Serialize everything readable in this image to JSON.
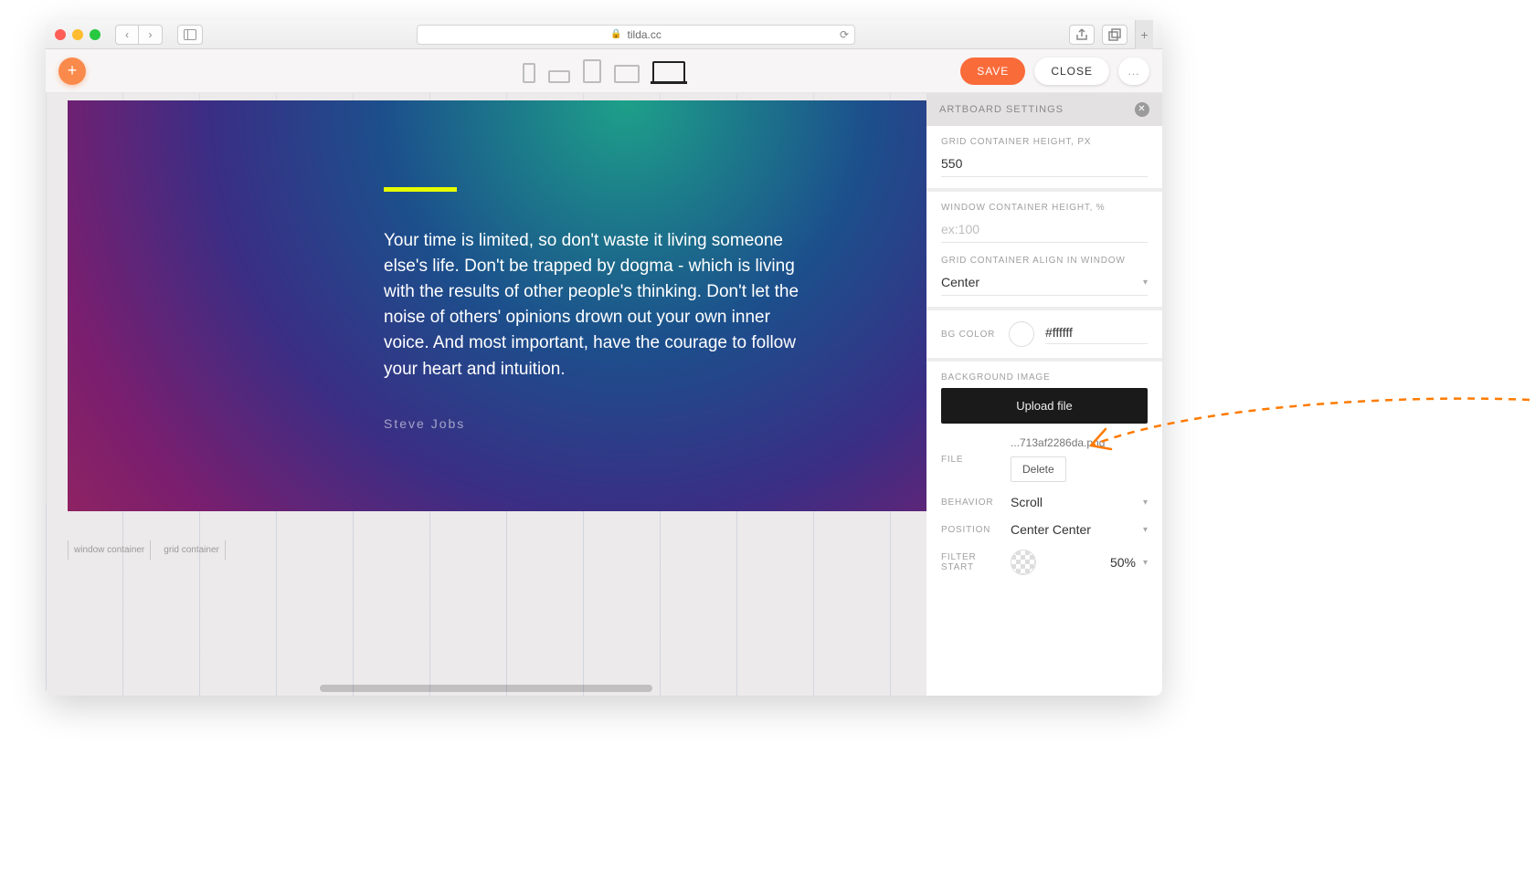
{
  "browser": {
    "url": "tilda.cc",
    "lock_icon": "🔒"
  },
  "appbar": {
    "save": "SAVE",
    "close": "CLOSE",
    "more": "..."
  },
  "canvas": {
    "quote": "Your time is limited, so don't waste it living someone else's life. Don't be trapped by dogma - which is living with the results of other people's thinking. Don't let the noise of others' opinions drown out your own inner voice. And most important, have the courage to follow your heart and intuition.",
    "attribution": "Steve Jobs",
    "rulers": {
      "window": "window container",
      "grid": "grid container"
    }
  },
  "panel": {
    "title": "ARTBOARD SETTINGS",
    "gridHeight": {
      "label": "GRID CONTAINER HEIGHT, PX",
      "value": "550"
    },
    "windowHeight": {
      "label": "WINDOW CONTAINER HEIGHT, %",
      "placeholder": "ex:100"
    },
    "align": {
      "label": "GRID CONTAINER ALIGN IN WINDOW",
      "value": "Center"
    },
    "bgcolor": {
      "label": "BG COLOR",
      "value": "#ffffff"
    },
    "bgimage": {
      "label": "BACKGROUND IMAGE",
      "upload": "Upload file",
      "fileLabel": "FILE",
      "fileName": "...713af2286da.png",
      "delete": "Delete",
      "behaviorLabel": "BEHAVIOR",
      "behavior": "Scroll",
      "positionLabel": "POSITION",
      "position": "Center Center",
      "filterStartLabel": "FILTER START",
      "filterStart": "50%"
    }
  }
}
